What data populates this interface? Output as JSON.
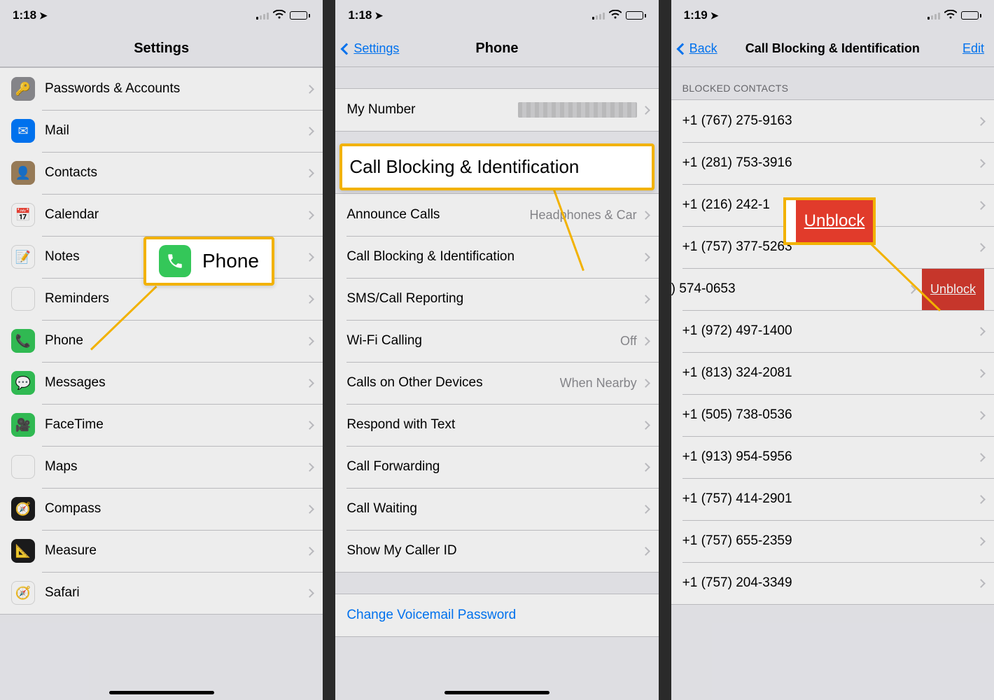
{
  "status": {
    "time1": "1:18",
    "time2": "1:18",
    "time3": "1:19"
  },
  "p1": {
    "title": "Settings",
    "rows": [
      {
        "id": "passwords",
        "label": "Passwords & Accounts",
        "iconClass": "ic-gray",
        "glyph": "🔑"
      },
      {
        "id": "mail",
        "label": "Mail",
        "iconClass": "ic-blue",
        "glyph": "✉︎"
      },
      {
        "id": "contacts",
        "label": "Contacts",
        "iconClass": "ic-brown",
        "glyph": "👤"
      },
      {
        "id": "calendar",
        "label": "Calendar",
        "iconClass": "ic-cal",
        "glyph": "📅"
      },
      {
        "id": "notes",
        "label": "Notes",
        "iconClass": "ic-yellow",
        "glyph": "📝"
      },
      {
        "id": "reminders",
        "label": "Reminders",
        "iconClass": "ic-rem",
        "glyph": "✔︎"
      },
      {
        "id": "phone",
        "label": "Phone",
        "iconClass": "ic-green",
        "glyph": "📞"
      },
      {
        "id": "messages",
        "label": "Messages",
        "iconClass": "ic-greenmsg",
        "glyph": "💬"
      },
      {
        "id": "facetime",
        "label": "FaceTime",
        "iconClass": "ic-ft",
        "glyph": "🎥"
      },
      {
        "id": "maps",
        "label": "Maps",
        "iconClass": "ic-maps",
        "glyph": "🗺︎"
      },
      {
        "id": "compass",
        "label": "Compass",
        "iconClass": "ic-compass",
        "glyph": "🧭"
      },
      {
        "id": "measure",
        "label": "Measure",
        "iconClass": "ic-measure",
        "glyph": "📐"
      },
      {
        "id": "safari",
        "label": "Safari",
        "iconClass": "ic-safari",
        "glyph": "🧭"
      }
    ],
    "callout_label": "Phone"
  },
  "p2": {
    "back": "Settings",
    "title": "Phone",
    "rows_top": [
      {
        "id": "mynumber",
        "label": "My Number",
        "value": ""
      }
    ],
    "callout_label": "Call Blocking & Identification",
    "rows_mid": [
      {
        "id": "announce",
        "label": "Announce Calls",
        "value": "Headphones & Car"
      },
      {
        "id": "blocking",
        "label": "Call Blocking & Identification"
      },
      {
        "id": "smsrep",
        "label": "SMS/Call Reporting"
      },
      {
        "id": "wifi",
        "label": "Wi-Fi Calling",
        "value": "Off"
      },
      {
        "id": "other",
        "label": "Calls on Other Devices",
        "value": "When Nearby"
      },
      {
        "id": "respond",
        "label": "Respond with Text"
      },
      {
        "id": "forward",
        "label": "Call Forwarding"
      },
      {
        "id": "waiting",
        "label": "Call Waiting"
      },
      {
        "id": "callerid",
        "label": "Show My Caller ID"
      }
    ],
    "voicemail": "Change Voicemail Password"
  },
  "p3": {
    "back": "Back",
    "title": "Call Blocking & Identification",
    "edit": "Edit",
    "section": "BLOCKED CONTACTS",
    "unblock_label": "Unblock",
    "contacts": [
      "+1 (767) 275-9163",
      "+1 (281) 753-3916",
      "+1 (216) 242-1",
      "+1 (757) 377-5263",
      ") 574-0653",
      "+1 (972) 497-1400",
      "+1 (813) 324-2081",
      "+1 (505) 738-0536",
      "+1 (913) 954-5956",
      "+1 (757) 414-2901",
      "+1 (757) 655-2359",
      "+1 (757) 204-3349"
    ],
    "callout_unblock": "Unblock"
  }
}
